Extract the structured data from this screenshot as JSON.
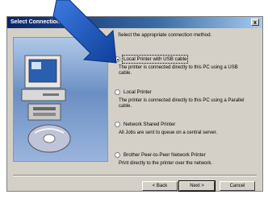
{
  "window": {
    "title": "Select Connection",
    "close_label": "x"
  },
  "instruction": "Select the appropriate connection method.",
  "options": [
    {
      "label": "Local Printer with USB cable",
      "description": "The printer is connected directly to this PC using a USB cable.",
      "selected": true
    },
    {
      "label": "Local Printer",
      "description": "The printer is connected directly to this PC using a Parallel cable.",
      "selected": false
    },
    {
      "label": "Network Shared Printer",
      "description": "All Jobs are sent to queue on a central server.",
      "selected": false
    },
    {
      "label": "Brother Peer-to-Peer Network Printer",
      "description": "Print directly to the printer over the network.",
      "selected": false
    }
  ],
  "buttons": {
    "back": "< Back",
    "next": "Next >",
    "cancel": "Cancel"
  },
  "colors": {
    "arrow": "#1f5cc4",
    "titlebar": "#0a246a",
    "dialog_bg": "#d4d0c8"
  }
}
